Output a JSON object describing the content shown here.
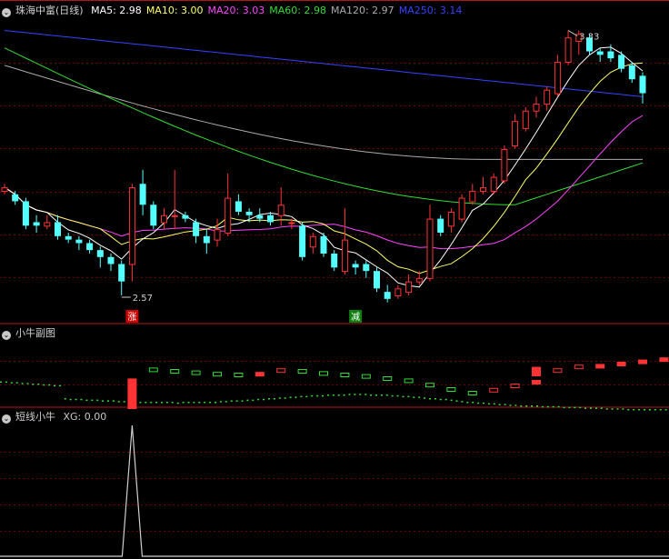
{
  "colors": {
    "up": "#ff3333",
    "down": "#54ffff",
    "grid": "#6b0000",
    "sep": "#b01818",
    "ma5": "#ffffff",
    "ma10": "#ffff66",
    "ma20": "#ff44ff",
    "ma60": "#33dd33",
    "ma120": "#aaaaaa",
    "ma250": "#3344ff",
    "label": "#d0d0d0",
    "xg": "#d0d0d0"
  },
  "panel1": {
    "icon": "chevron-down-icon",
    "title": "珠海中富(日线)",
    "ma": [
      {
        "label": "MA5: 2.98",
        "key": "ma5"
      },
      {
        "label": "MA10: 3.00",
        "key": "ma10"
      },
      {
        "label": "MA20: 3.03",
        "key": "ma20"
      },
      {
        "label": "MA60: 2.98",
        "key": "ma60"
      },
      {
        "label": "MA120: 2.97",
        "key": "ma120"
      },
      {
        "label": "MA250: 3.14",
        "key": "ma250"
      }
    ]
  },
  "panel2": {
    "icon": "chevron-down-icon",
    "title": "小牛副图"
  },
  "panel3": {
    "icon": "chevron-down-icon",
    "title": "短线小牛",
    "xg_label": "XG: 0.00"
  },
  "chart_data": [
    {
      "type": "candlestick",
      "y_range": [
        2.51,
        3.36
      ],
      "annotations": [
        {
          "text": "3.33",
          "kind": "high",
          "index": 53
        },
        {
          "text": "2.57",
          "kind": "low",
          "index": 11
        },
        {
          "text": "涨",
          "kind": "buy-signal",
          "index": 12
        },
        {
          "text": "减",
          "kind": "sell-signal",
          "index": 33
        }
      ],
      "candles": [
        [
          2.87,
          2.88,
          2.86,
          2.89
        ],
        [
          2.86,
          2.84,
          2.83,
          2.87
        ],
        [
          2.84,
          2.77,
          2.76,
          2.85
        ],
        [
          2.78,
          2.77,
          2.75,
          2.8
        ],
        [
          2.77,
          2.78,
          2.76,
          2.8
        ],
        [
          2.78,
          2.74,
          2.73,
          2.8
        ],
        [
          2.74,
          2.73,
          2.72,
          2.75
        ],
        [
          2.73,
          2.72,
          2.7,
          2.74
        ],
        [
          2.72,
          2.7,
          2.69,
          2.73
        ],
        [
          2.7,
          2.68,
          2.65,
          2.71
        ],
        [
          2.68,
          2.66,
          2.64,
          2.69
        ],
        [
          2.66,
          2.61,
          2.57,
          2.67
        ],
        [
          2.66,
          2.88,
          2.61,
          2.89
        ],
        [
          2.89,
          2.83,
          2.8,
          2.93
        ],
        [
          2.83,
          2.77,
          2.76,
          2.84
        ],
        [
          2.78,
          2.8,
          2.76,
          2.82
        ],
        [
          2.8,
          2.8,
          2.76,
          2.93
        ],
        [
          2.8,
          2.79,
          2.78,
          2.81
        ],
        [
          2.78,
          2.74,
          2.72,
          2.79
        ],
        [
          2.74,
          2.72,
          2.69,
          2.76
        ],
        [
          2.73,
          2.76,
          2.71,
          2.79
        ],
        [
          2.75,
          2.85,
          2.74,
          2.92
        ],
        [
          2.84,
          2.81,
          2.8,
          2.86
        ],
        [
          2.81,
          2.8,
          2.78,
          2.82
        ],
        [
          2.8,
          2.79,
          2.78,
          2.82
        ],
        [
          2.8,
          2.78,
          2.77,
          2.81
        ],
        [
          2.8,
          2.83,
          2.77,
          2.88
        ],
        [
          2.78,
          2.78,
          2.76,
          2.79
        ],
        [
          2.77,
          2.68,
          2.67,
          2.78
        ],
        [
          2.71,
          2.74,
          2.69,
          2.75
        ],
        [
          2.74,
          2.69,
          2.68,
          2.75
        ],
        [
          2.69,
          2.65,
          2.64,
          2.7
        ],
        [
          2.64,
          2.73,
          2.63,
          2.82
        ],
        [
          2.66,
          2.65,
          2.63,
          2.67
        ],
        [
          2.66,
          2.64,
          2.62,
          2.67
        ],
        [
          2.64,
          2.59,
          2.58,
          2.65
        ],
        [
          2.58,
          2.56,
          2.55,
          2.6
        ],
        [
          2.57,
          2.59,
          2.56,
          2.6
        ],
        [
          2.58,
          2.61,
          2.57,
          2.63
        ],
        [
          2.61,
          2.62,
          2.6,
          2.64
        ],
        [
          2.62,
          2.79,
          2.61,
          2.83
        ],
        [
          2.79,
          2.75,
          2.74,
          2.8
        ],
        [
          2.77,
          2.81,
          2.75,
          2.82
        ],
        [
          2.79,
          2.85,
          2.78,
          2.86
        ],
        [
          2.84,
          2.87,
          2.83,
          2.89
        ],
        [
          2.87,
          2.88,
          2.86,
          2.91
        ],
        [
          2.87,
          2.91,
          2.86,
          2.92
        ],
        [
          2.9,
          2.99,
          2.89,
          3.0
        ],
        [
          3.0,
          3.07,
          2.99,
          3.09
        ],
        [
          3.05,
          3.1,
          3.04,
          3.11
        ],
        [
          3.1,
          3.12,
          3.08,
          3.14
        ],
        [
          3.12,
          3.16,
          3.1,
          3.17
        ],
        [
          3.15,
          3.24,
          3.14,
          3.26
        ],
        [
          3.24,
          3.31,
          3.23,
          3.33
        ],
        [
          3.3,
          3.32,
          3.26,
          3.33
        ],
        [
          3.31,
          3.27,
          3.26,
          3.32
        ],
        [
          3.27,
          3.26,
          3.24,
          3.28
        ],
        [
          3.27,
          3.25,
          3.24,
          3.29
        ],
        [
          3.26,
          3.22,
          3.21,
          3.27
        ],
        [
          3.23,
          3.19,
          3.18,
          3.24
        ],
        [
          3.2,
          3.15,
          3.12,
          3.21
        ]
      ]
    },
    {
      "type": "bar",
      "series_name": "小牛副图",
      "y_range": [
        0,
        100
      ],
      "values": [
        20,
        20,
        19,
        19,
        18,
        18,
        17,
        17,
        16,
        16,
        15,
        15,
        15,
        14,
        14,
        14,
        13,
        13,
        13,
        12,
        12,
        12,
        11,
        11,
        11,
        10,
        10,
        10,
        10,
        10,
        10,
        10,
        10,
        9,
        10,
        10,
        10,
        10,
        10,
        10,
        10,
        11,
        11,
        12,
        12,
        12,
        13,
        13,
        14,
        14,
        15,
        15,
        16,
        16,
        17,
        17,
        18,
        18,
        19,
        19,
        19,
        20,
        20,
        20,
        20,
        21,
        21,
        21,
        21,
        20,
        20,
        20,
        20,
        19,
        19,
        18,
        18,
        17,
        17,
        16,
        15,
        15,
        14,
        14,
        13,
        12,
        11,
        10,
        10,
        9,
        9,
        8,
        8,
        7,
        7,
        6,
        6,
        5,
        5,
        5,
        5,
        4,
        4,
        4,
        4,
        3,
        3,
        3,
        3,
        2,
        2,
        2,
        2,
        1,
        1,
        1,
        1,
        0,
        0,
        0,
        0,
        0,
        0,
        0,
        0,
        0
      ],
      "blocks": [
        {
          "i": 12,
          "v": 42,
          "kind": "up-solid"
        },
        {
          "i": 14,
          "v": 57,
          "kind": "down-hollow"
        },
        {
          "i": 16,
          "v": 55,
          "kind": "down-hollow"
        },
        {
          "i": 18,
          "v": 53,
          "kind": "down-hollow"
        },
        {
          "i": 20,
          "v": 51,
          "kind": "down-hollow"
        },
        {
          "i": 22,
          "v": 50,
          "kind": "down-hollow"
        },
        {
          "i": 24,
          "v": 51,
          "kind": "up-solid"
        },
        {
          "i": 26,
          "v": 56,
          "kind": "up-hollow"
        },
        {
          "i": 28,
          "v": 55,
          "kind": "down-hollow"
        },
        {
          "i": 30,
          "v": 52,
          "kind": "down-hollow"
        },
        {
          "i": 32,
          "v": 50,
          "kind": "down-hollow"
        },
        {
          "i": 34,
          "v": 48,
          "kind": "down-hollow"
        },
        {
          "i": 36,
          "v": 45,
          "kind": "down-hollow"
        },
        {
          "i": 38,
          "v": 42,
          "kind": "down-hollow"
        },
        {
          "i": 40,
          "v": 36,
          "kind": "down-hollow"
        },
        {
          "i": 42,
          "v": 30,
          "kind": "down-hollow"
        },
        {
          "i": 44,
          "v": 25,
          "kind": "down-hollow"
        },
        {
          "i": 46,
          "v": 29,
          "kind": "up-hollow"
        },
        {
          "i": 48,
          "v": 35,
          "kind": "up-hollow"
        },
        {
          "i": 50,
          "v": 40,
          "kind": "up-solid"
        },
        {
          "i": 52,
          "v": 56,
          "kind": "up-hollow"
        },
        {
          "i": 54,
          "v": 61,
          "kind": "up-hollow"
        },
        {
          "i": 56,
          "v": 62,
          "kind": "up-solid"
        },
        {
          "i": 58,
          "v": 65,
          "kind": "up-solid"
        },
        {
          "i": 60,
          "v": 68,
          "kind": "up-solid"
        },
        {
          "i": 62,
          "v": 71,
          "kind": "up-solid"
        },
        {
          "i": 64,
          "v": 74,
          "kind": "up-hollow"
        },
        {
          "i": 66,
          "v": 77,
          "kind": "up-solid"
        },
        {
          "i": 68,
          "v": 80,
          "kind": "up-solid"
        },
        {
          "i": 70,
          "v": 82,
          "kind": "up-solid"
        },
        {
          "i": 72,
          "v": 84,
          "kind": "up-solid"
        },
        {
          "i": 74,
          "v": 85,
          "kind": "up-solid"
        },
        {
          "i": 76,
          "v": 86,
          "kind": "down-solid"
        },
        {
          "i": 78,
          "v": 83,
          "kind": "down-hollow"
        },
        {
          "i": 80,
          "v": 76,
          "kind": "down-hollow"
        },
        {
          "i": 82,
          "v": 70,
          "kind": "down-hollow"
        }
      ]
    },
    {
      "type": "line",
      "series_name": "XG",
      "y_range": [
        0,
        1
      ],
      "signal_index": 12,
      "signal_value": 1
    }
  ]
}
